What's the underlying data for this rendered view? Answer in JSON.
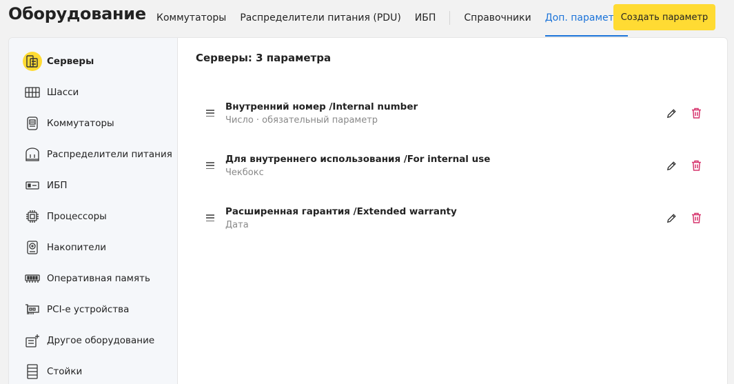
{
  "header": {
    "title": "Оборудование",
    "nav": [
      {
        "label": "Коммутаторы",
        "active": false
      },
      {
        "label": "Распределители питания (PDU)",
        "active": false
      },
      {
        "label": "ИБП",
        "active": false
      },
      {
        "label": "Справочники",
        "active": false
      },
      {
        "label": "Доп. параметры",
        "active": true
      }
    ],
    "create_button": "Создать параметр"
  },
  "sidebar": {
    "items": [
      {
        "label": "Серверы",
        "icon": "server-icon",
        "active": true
      },
      {
        "label": "Шасси",
        "icon": "chassis-icon",
        "active": false
      },
      {
        "label": "Коммутаторы",
        "icon": "switch-icon",
        "active": false
      },
      {
        "label": "Распределители питания",
        "icon": "pdu-icon",
        "active": false
      },
      {
        "label": "ИБП",
        "icon": "ups-icon",
        "active": false
      },
      {
        "label": "Процессоры",
        "icon": "cpu-icon",
        "active": false
      },
      {
        "label": "Накопители",
        "icon": "drive-icon",
        "active": false
      },
      {
        "label": "Оперативная память",
        "icon": "ram-icon",
        "active": false
      },
      {
        "label": "PCI-e устройства",
        "icon": "pcie-icon",
        "active": false
      },
      {
        "label": "Другое оборудование",
        "icon": "other-equipment-icon",
        "active": false
      },
      {
        "label": "Стойки",
        "icon": "rack-icon",
        "active": false
      }
    ]
  },
  "main": {
    "section_title": "Серверы: 3 параметра",
    "params": [
      {
        "name": "Внутренний номер /Internal number",
        "subtitle": "Число · обязательный параметр"
      },
      {
        "name": "Для внутреннего использования /For internal use",
        "subtitle": "Чекбокс"
      },
      {
        "name": "Расширенная гарантия /Extended warranty",
        "subtitle": "Дата"
      }
    ]
  },
  "colors": {
    "accent": "#1a73d9",
    "button_yellow": "#ffdb33",
    "delete_red": "#d6336c"
  }
}
